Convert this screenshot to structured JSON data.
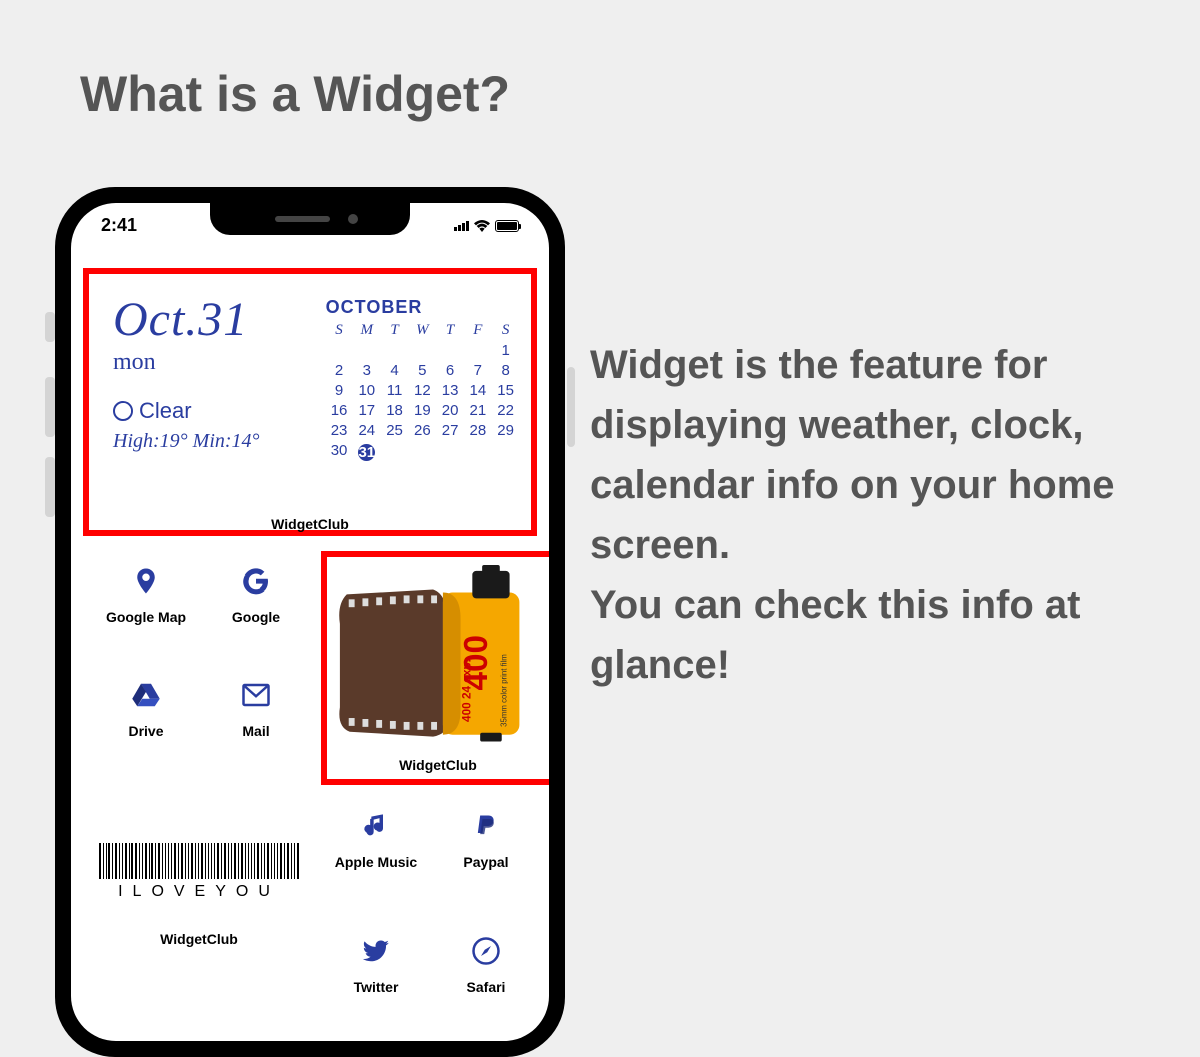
{
  "headline": "What is a Widget?",
  "body": "Widget is the feature for displaying weather, clock, calendar info on your home screen.\nYou can check this info at glance!",
  "phone": {
    "status_time": "2:41",
    "calendar_widget": {
      "date": "Oct.31",
      "weekday": "mon",
      "weather": "Clear",
      "highmin": "High:19° Min:14°",
      "month": "OCTOBER",
      "dow": [
        "S",
        "M",
        "T",
        "W",
        "T",
        "F",
        "S"
      ],
      "days": [
        "",
        "",
        "",
        "",
        "",
        "",
        "1",
        "2",
        "3",
        "4",
        "5",
        "6",
        "7",
        "8",
        "9",
        "10",
        "11",
        "12",
        "13",
        "14",
        "15",
        "16",
        "17",
        "18",
        "19",
        "20",
        "21",
        "22",
        "23",
        "24",
        "25",
        "26",
        "27",
        "28",
        "29",
        "30",
        "31"
      ],
      "highlighted_day": "31",
      "sub_label": "WidgetClub"
    },
    "film_widget": {
      "label": "WidgetClub",
      "film_text_1": "400",
      "film_text_2": "400 24 exp.",
      "film_text_3": "35mm color print film"
    },
    "barcode_widget": {
      "text": "ILOVEYOU",
      "label": "WidgetClub"
    },
    "apps_left": [
      {
        "icon": "map-pin-icon",
        "label": "Google Map"
      },
      {
        "icon": "google-icon",
        "label": "Google"
      },
      {
        "icon": "drive-icon",
        "label": "Drive"
      },
      {
        "icon": "mail-icon",
        "label": "Mail"
      }
    ],
    "apps_row3": [
      {
        "icon": "music-icon",
        "label": "Apple Music"
      },
      {
        "icon": "paypal-icon",
        "label": "Paypal"
      }
    ],
    "apps_row4": [
      {
        "icon": "twitter-icon",
        "label": "Twitter"
      },
      {
        "icon": "safari-icon",
        "label": "Safari"
      }
    ]
  }
}
